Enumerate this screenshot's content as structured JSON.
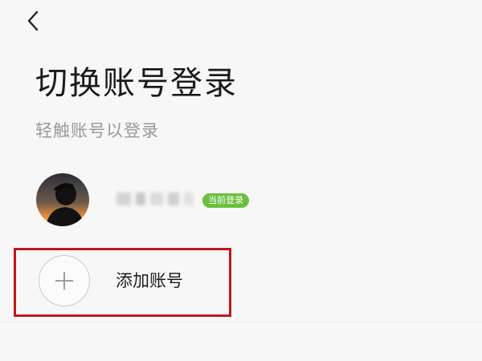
{
  "header": {
    "back_icon": "chevron-left-icon"
  },
  "main": {
    "title": "切换账号登录",
    "subtitle": "轻触账号以登录"
  },
  "accounts": [
    {
      "avatar_icon": "user-avatar",
      "badge": "当前登录",
      "badge_color": "#6abf3e"
    }
  ],
  "add_account": {
    "icon": "plus-icon",
    "label": "添加账号",
    "highlight_color": "#c0171a"
  }
}
